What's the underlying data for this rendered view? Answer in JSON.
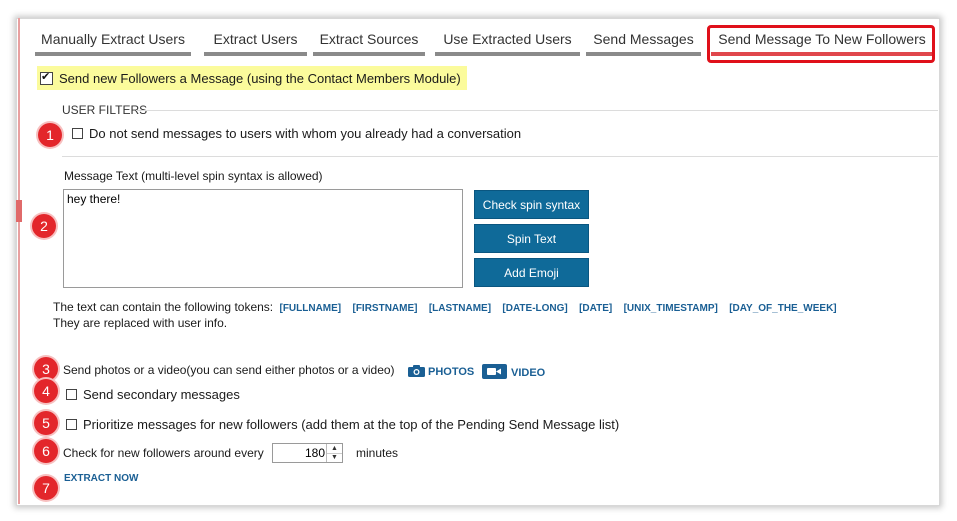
{
  "tabs": [
    {
      "label": "Manually Extract Users",
      "active": false
    },
    {
      "label": "Extract Users",
      "active": false
    },
    {
      "label": "Extract Sources",
      "active": false
    },
    {
      "label": "Use Extracted Users",
      "active": false
    },
    {
      "label": "Send Messages",
      "active": false
    },
    {
      "label": "Send Message To New Followers",
      "active": true
    }
  ],
  "main_checkbox": {
    "label": "Send new Followers a Message (using the Contact Members Module)",
    "checked": true
  },
  "user_filters": {
    "title": "USER FILTERS",
    "no_conversation": {
      "label": "Do not send messages to users with whom you already had a conversation",
      "checked": false
    }
  },
  "message": {
    "label": "Message Text  (multi-level spin syntax is allowed)",
    "value": "hey there!",
    "buttons": {
      "check_spin": "Check spin syntax",
      "spin_text": "Spin Text",
      "add_emoji": "Add Emoji"
    }
  },
  "tokens": {
    "intro": "The text can contain the following tokens:",
    "list": [
      "[FULLNAME]",
      "[FIRSTNAME]",
      "[LASTNAME]",
      "[DATE-LONG]",
      "[DATE]",
      "[UNIX_TIMESTAMP]",
      "[DAY_OF_THE_WEEK]"
    ],
    "note": "They are replaced with user info."
  },
  "media": {
    "label": "Send photos or a video(you can send either photos or a video)",
    "photos": "PHOTOS",
    "video": "VIDEO"
  },
  "secondary": {
    "label": "Send secondary messages",
    "checked": false
  },
  "prioritize": {
    "label": "Prioritize messages for new followers (add them at the top of the Pending Send Message list)",
    "checked": false
  },
  "check_interval": {
    "label": "Check for new followers around every",
    "value": "180",
    "unit": "minutes"
  },
  "extract_now": "EXTRACT NOW",
  "badges": [
    "1",
    "2",
    "3",
    "4",
    "5",
    "6",
    "7"
  ],
  "colors": {
    "accent": "#0f6a99",
    "badge": "#e3262b",
    "highlight": "#fbfb9c",
    "active_tab": "#e0474c"
  }
}
